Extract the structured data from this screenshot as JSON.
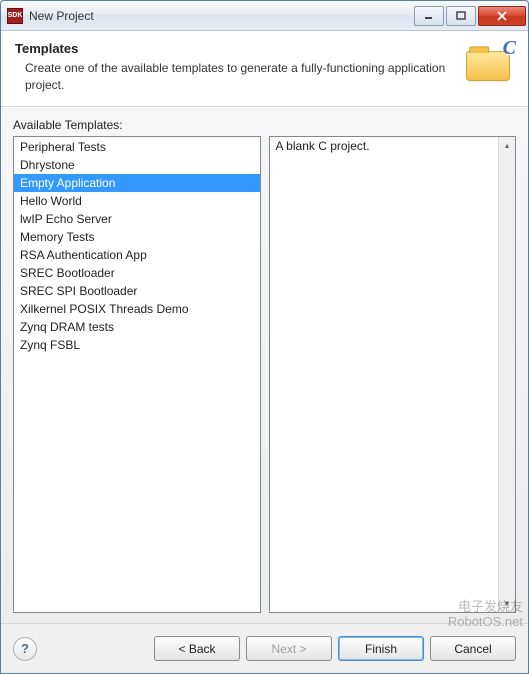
{
  "window": {
    "title": "New Project",
    "app_icon_label": "SDK"
  },
  "header": {
    "title": "Templates",
    "description": "Create one of the available templates to generate a fully-functioning application project.",
    "badge": "C"
  },
  "available_label": "Available Templates:",
  "templates": [
    "Peripheral Tests",
    "Dhrystone",
    "Empty Application",
    "Hello World",
    "lwIP Echo Server",
    "Memory Tests",
    "RSA Authentication App",
    "SREC Bootloader",
    "SREC SPI Bootloader",
    "Xilkernel POSIX Threads Demo",
    "Zynq DRAM tests",
    "Zynq FSBL"
  ],
  "selected_index": 2,
  "description_text": "A blank C project.",
  "buttons": {
    "back": "< Back",
    "next": "Next >",
    "finish": "Finish",
    "cancel": "Cancel",
    "help": "?"
  },
  "watermark": "电子发烧友\nRobotOS.net"
}
